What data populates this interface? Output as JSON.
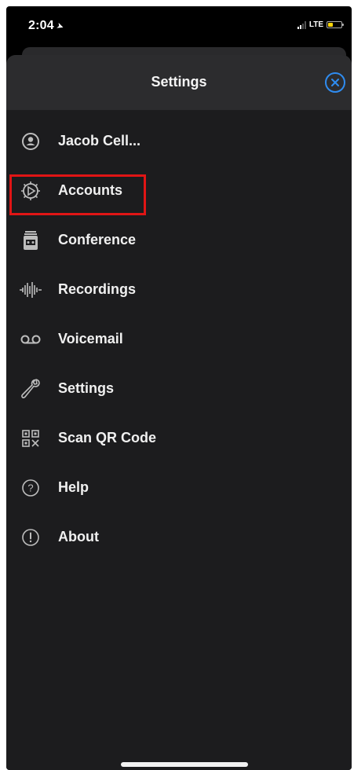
{
  "status_bar": {
    "time": "2:04",
    "network": "LTE",
    "colors": {
      "battery": "#ffd60a"
    }
  },
  "header": {
    "title": "Settings",
    "close_icon": "close-circle-icon",
    "accent_color": "#2f8cf0"
  },
  "menu": {
    "items": [
      {
        "label": "Jacob Cell...",
        "icon": "user-circle-icon"
      },
      {
        "label": "Accounts",
        "icon": "account-dial-icon"
      },
      {
        "label": "Conference",
        "icon": "conference-icon"
      },
      {
        "label": "Recordings",
        "icon": "waveform-icon"
      },
      {
        "label": "Voicemail",
        "icon": "voicemail-icon"
      },
      {
        "label": "Settings",
        "icon": "wrench-icon"
      },
      {
        "label": "Scan QR Code",
        "icon": "qr-code-icon"
      },
      {
        "label": "Help",
        "icon": "help-circle-icon"
      },
      {
        "label": "About",
        "icon": "info-circle-icon"
      }
    ],
    "highlighted_item": "Accounts",
    "highlight_color": "#e01515"
  }
}
